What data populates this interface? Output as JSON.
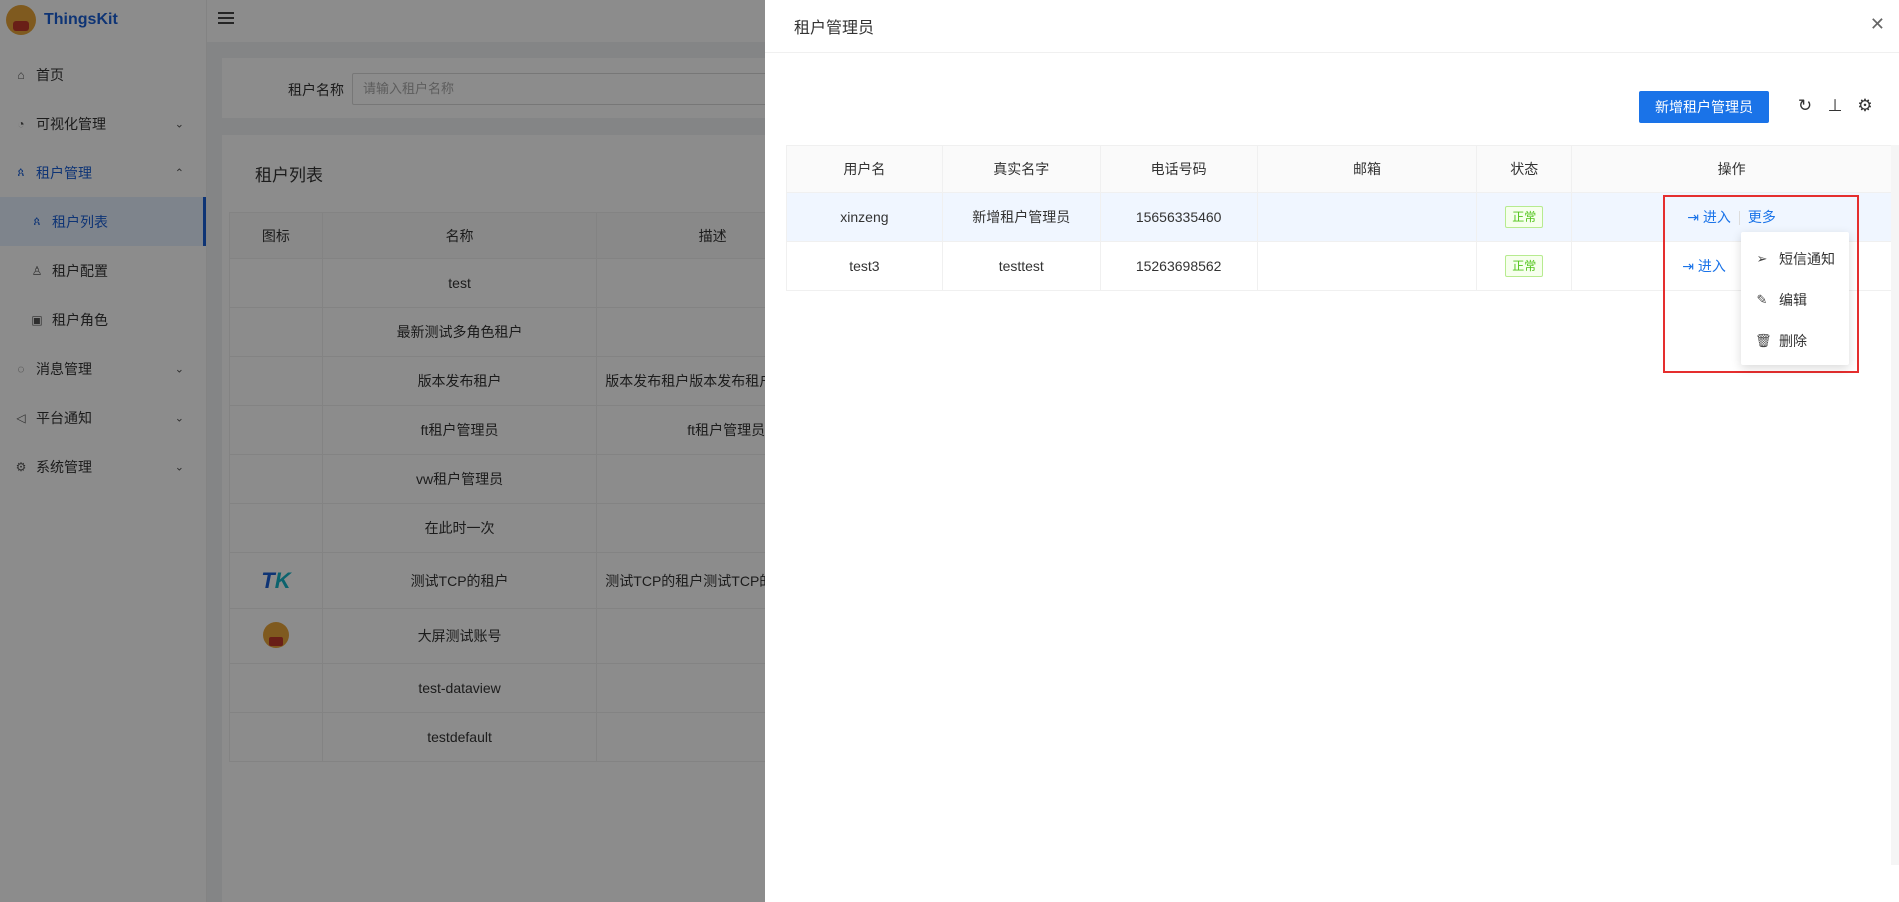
{
  "app": {
    "name": "ThingsKit"
  },
  "sidebar": {
    "items": [
      {
        "label": "首页",
        "icon": "home-icon",
        "has_chevron": false
      },
      {
        "label": "可视化管理",
        "icon": "dashboard-icon",
        "has_chevron": true
      },
      {
        "label": "租户管理",
        "icon": "tenant-icon",
        "has_chevron": true,
        "open": true
      },
      {
        "label": "租户列表",
        "icon": "tenant-list-icon",
        "sub": true,
        "active": true
      },
      {
        "label": "租户配置",
        "icon": "user-icon",
        "sub": true
      },
      {
        "label": "租户角色",
        "icon": "role-icon",
        "sub": true
      },
      {
        "label": "消息管理",
        "icon": "message-icon",
        "has_chevron": true
      },
      {
        "label": "平台通知",
        "icon": "notice-icon",
        "has_chevron": true
      },
      {
        "label": "系统管理",
        "icon": "gear-icon",
        "has_chevron": true
      }
    ]
  },
  "search": {
    "label": "租户名称",
    "placeholder": "请输入租户名称"
  },
  "tenant_list": {
    "title": "租户列表",
    "columns": [
      "图标",
      "名称",
      "描述"
    ],
    "rows": [
      {
        "icon": "",
        "name": "test",
        "desc": ""
      },
      {
        "icon": "",
        "name": "最新测试多角色租户",
        "desc": ""
      },
      {
        "icon": "",
        "name": "版本发布租户",
        "desc": "版本发布租户版本发布租户"
      },
      {
        "icon": "",
        "name": "ft租户管理员",
        "desc": "ft租户管理员"
      },
      {
        "icon": "",
        "name": "vw租户管理员",
        "desc": ""
      },
      {
        "icon": "",
        "name": "在此时一次",
        "desc": ""
      },
      {
        "icon": "tk-logo",
        "name": "测试TCP的租户",
        "desc": "测试TCP的租户测试TCP的"
      },
      {
        "icon": "bear-logo",
        "name": "大屏测试账号",
        "desc": ""
      },
      {
        "icon": "",
        "name": "test-dataview",
        "desc": ""
      },
      {
        "icon": "",
        "name": "testdefault",
        "desc": ""
      }
    ]
  },
  "drawer": {
    "title": "租户管理员",
    "add_button": "新增租户管理员",
    "columns": [
      "用户名",
      "真实名字",
      "电话号码",
      "邮箱",
      "状态",
      "操作"
    ],
    "rows": [
      {
        "username": "xinzeng",
        "realname": "新增租户管理员",
        "phone": "15656335460",
        "email": "",
        "status": "正常",
        "enter": "进入",
        "more": "更多"
      },
      {
        "username": "test3",
        "realname": "testtest",
        "phone": "15263698562",
        "email": "",
        "status": "正常",
        "enter": "进入"
      }
    ],
    "dropdown": [
      {
        "label": "短信通知",
        "icon": "send-icon"
      },
      {
        "label": "编辑",
        "icon": "edit-icon"
      },
      {
        "label": "删除",
        "icon": "trash-icon"
      }
    ]
  },
  "colors": {
    "primary": "#1a73e8",
    "status_green": "#52c41a",
    "highlight_red": "#e52e2e"
  }
}
